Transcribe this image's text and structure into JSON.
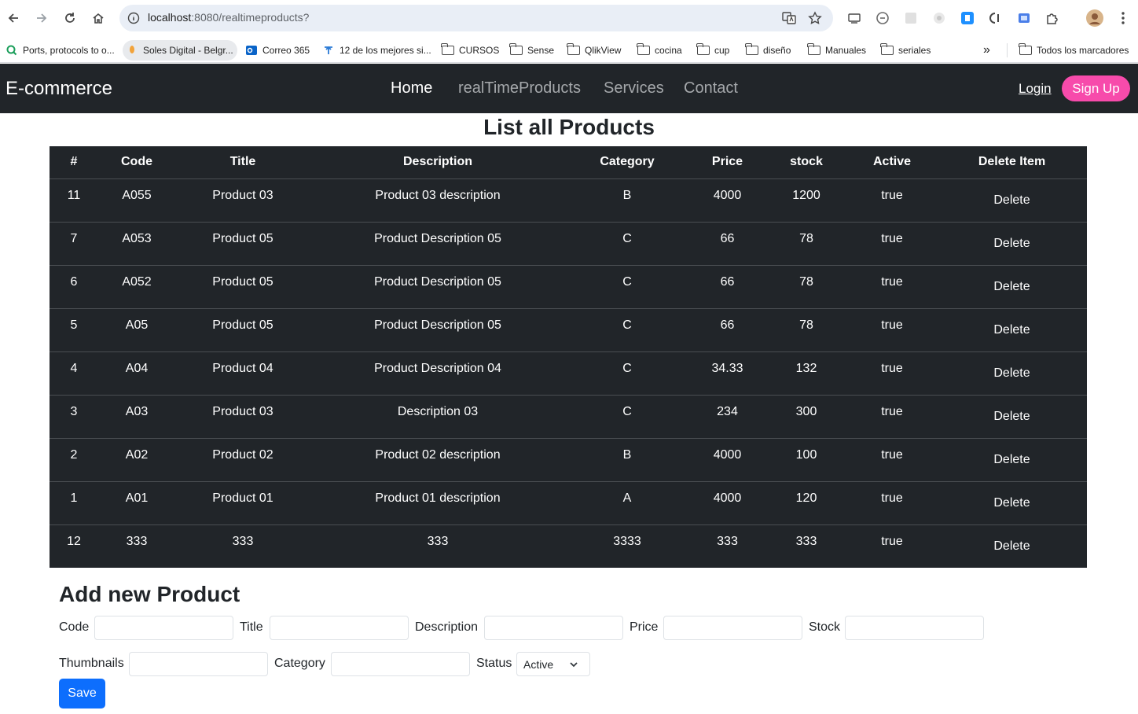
{
  "browser": {
    "url_host": "localhost",
    "url_path": ":8080/realtimeproducts?",
    "bookmarks": [
      {
        "label": "Ports, protocols to o..."
      },
      {
        "label": "Soles Digital - Belgr..."
      },
      {
        "label": "Correo 365"
      },
      {
        "label": "12 de los mejores si..."
      },
      {
        "label": "CURSOS"
      },
      {
        "label": "Sense"
      },
      {
        "label": "QlikView"
      },
      {
        "label": "cocina"
      },
      {
        "label": "cup"
      },
      {
        "label": "diseño"
      },
      {
        "label": "Manuales"
      },
      {
        "label": "seriales"
      }
    ],
    "overflow": "»",
    "all_bookmarks": "Todos los marcadores"
  },
  "nav": {
    "brand": "E-commerce",
    "links": [
      "Home",
      "realTimeProducts",
      "Services",
      "Contact"
    ],
    "login": "Login",
    "signup": "Sign Up"
  },
  "products": {
    "title": "List all Products",
    "columns": [
      "#",
      "Code",
      "Title",
      "Description",
      "Category",
      "Price",
      "stock",
      "Active",
      "Delete Item"
    ],
    "rows": [
      [
        "11",
        "A055",
        "Product 03",
        "Product 03 description",
        "B",
        "4000",
        "1200",
        "true"
      ],
      [
        "7",
        "A053",
        "Product 05",
        "Product Description 05",
        "C",
        "66",
        "78",
        "true"
      ],
      [
        "6",
        "A052",
        "Product 05",
        "Product Description 05",
        "C",
        "66",
        "78",
        "true"
      ],
      [
        "5",
        "A05",
        "Product 05",
        "Product Description 05",
        "C",
        "66",
        "78",
        "true"
      ],
      [
        "4",
        "A04",
        "Product 04",
        "Product Description 04",
        "C",
        "34.33",
        "132",
        "true"
      ],
      [
        "3",
        "A03",
        "Product 03",
        "Description 03",
        "C",
        "234",
        "300",
        "true"
      ],
      [
        "2",
        "A02",
        "Product 02",
        "Product 02 description",
        "B",
        "4000",
        "100",
        "true"
      ],
      [
        "1",
        "A01",
        "Product 01",
        "Product 01 description",
        "A",
        "4000",
        "120",
        "true"
      ],
      [
        "12",
        "333",
        "333",
        "333",
        "3333",
        "333",
        "333",
        "true"
      ]
    ],
    "delete_label": "Delete"
  },
  "form": {
    "title": "Add new Product",
    "labels": {
      "code": "Code",
      "title": "Title",
      "description": "Description",
      "price": "Price",
      "stock": "Stock",
      "thumbnails": "Thumbnails",
      "category": "Category",
      "status": "Status"
    },
    "status_value": "Active",
    "save": "Save"
  },
  "colors": {
    "navbar": "#212529",
    "signup": "#f74bab",
    "save": "#0d6efd"
  }
}
